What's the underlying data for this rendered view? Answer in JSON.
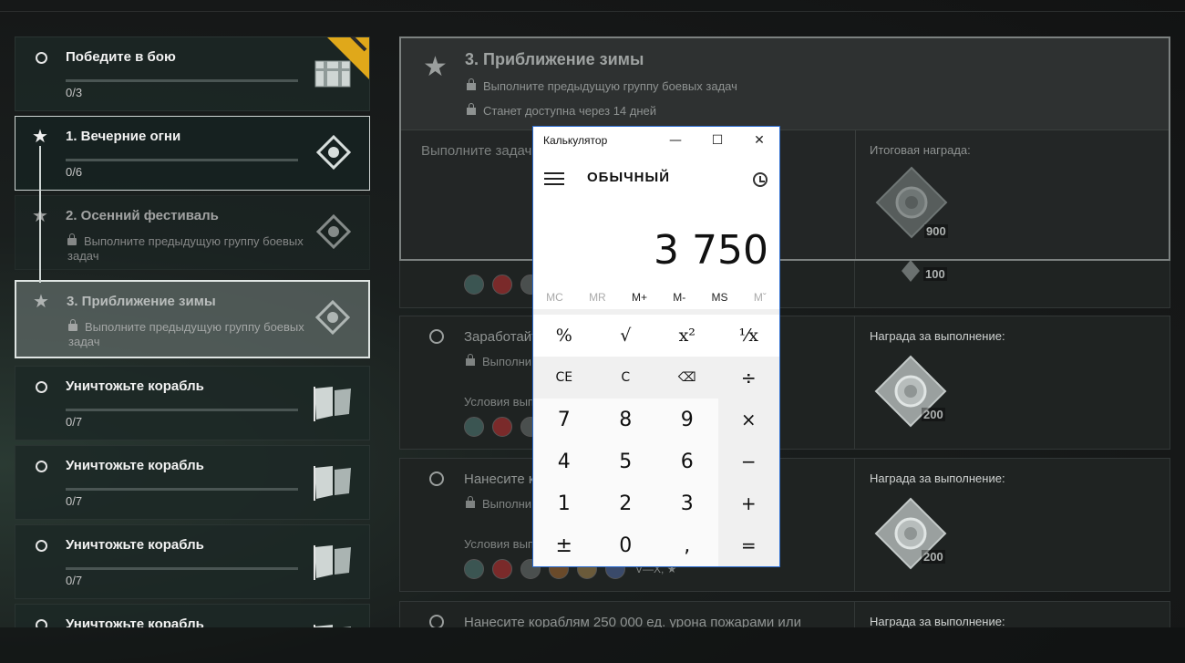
{
  "top": {
    "glyph": "·"
  },
  "left_list": {
    "items": [
      {
        "type": "circle",
        "title": "Победите в бою",
        "progress": "0/3",
        "icon": "chest-icon",
        "badge": true
      },
      {
        "type": "star",
        "title": "1. Вечерние огни",
        "progress": "0/6",
        "icon": "diamond-emblem-icon"
      },
      {
        "type": "star",
        "title": "2. Осенний фестиваль",
        "lock_text": "Выполните предыдущую группу боевых задач",
        "icon": "diamond-emblem-icon"
      },
      {
        "type": "star",
        "title": "3. Приближение зимы",
        "lock_text": "Выполните предыдущую группу боевых задач",
        "icon": "diamond-emblem-icon"
      },
      {
        "type": "circle",
        "title": "Уничтожьте корабль",
        "progress": "0/7",
        "icon": "flag-icon"
      },
      {
        "type": "circle",
        "title": "Уничтожьте корабль",
        "progress": "0/7",
        "icon": "flag-icon"
      },
      {
        "type": "circle",
        "title": "Уничтожьте корабль",
        "progress": "0/7",
        "icon": "flag-icon"
      },
      {
        "type": "circle",
        "title": "Уничтожьте корабль",
        "icon": "flag-icon"
      }
    ]
  },
  "detail": {
    "header": {
      "title": "3. Приближение зимы",
      "line1": "Выполните предыдущую группу боевых задач",
      "line2": "Станет доступна через 14 дней",
      "subtitle": "Выполните задачи",
      "reward_label": "Итоговая награда:",
      "reward_value": "900"
    },
    "peek_reward_value": "100",
    "tasks": [
      {
        "title": "Заработайт",
        "lock": "Выполни",
        "cond": "Условия вып",
        "reward_label": "Награда за выполнение:",
        "reward_value": "200"
      },
      {
        "title": "Нанесите к",
        "lock": "Выполни",
        "cond": "Условия вып",
        "tier": "V—X, ★",
        "reward_label": "Награда за выполнение:",
        "reward_value": "200"
      },
      {
        "title": "Нанесите кораблям 250 000 ед. урона пожарами или",
        "reward_label": "Награда за выполнение:"
      }
    ]
  },
  "calculator": {
    "title": "Калькулятор",
    "mode": "ОБЫЧНЫЙ",
    "display": "3 750",
    "memory": [
      "MC",
      "MR",
      "M+",
      "M-",
      "MS",
      "Mˇ"
    ],
    "sci": [
      "%",
      "√",
      "x²",
      "¹⁄x"
    ],
    "keys": [
      "CE",
      "C",
      "⌫",
      "÷",
      "7",
      "8",
      "9",
      "×",
      "4",
      "5",
      "6",
      "−",
      "1",
      "2",
      "3",
      "+",
      "±",
      "0",
      ",",
      "="
    ],
    "window_buttons": {
      "minimize": "—",
      "maximize": "☐",
      "close": "✕"
    }
  }
}
